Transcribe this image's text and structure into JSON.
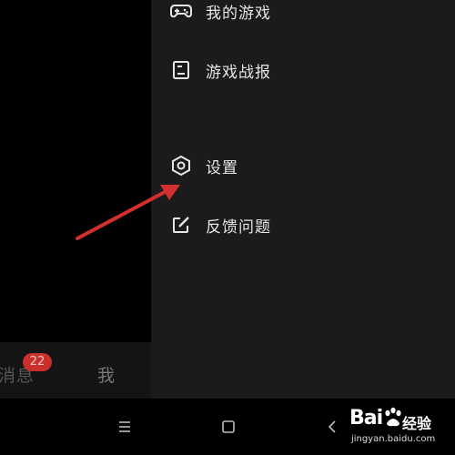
{
  "tabs": {
    "messages_label": "消息",
    "messages_badge": "22",
    "me_label": "我"
  },
  "drawer": {
    "items": [
      {
        "label": "我的游戏",
        "icon": "gamepad-icon"
      },
      {
        "label": "游戏战报",
        "icon": "report-icon"
      },
      {
        "label": "设置",
        "icon": "settings-hexagon-icon"
      },
      {
        "label": "反馈问题",
        "icon": "feedback-edit-icon"
      }
    ]
  },
  "navbar": {
    "menu_icon": "menu-lines-icon",
    "home_icon": "square-home-icon",
    "back_icon": "chevron-back-icon"
  },
  "annotation": {
    "arrow_color": "#d32f2f"
  },
  "watermark": {
    "brand": "Bai",
    "cn": "经验",
    "url": "jingyan.baidu.com"
  }
}
